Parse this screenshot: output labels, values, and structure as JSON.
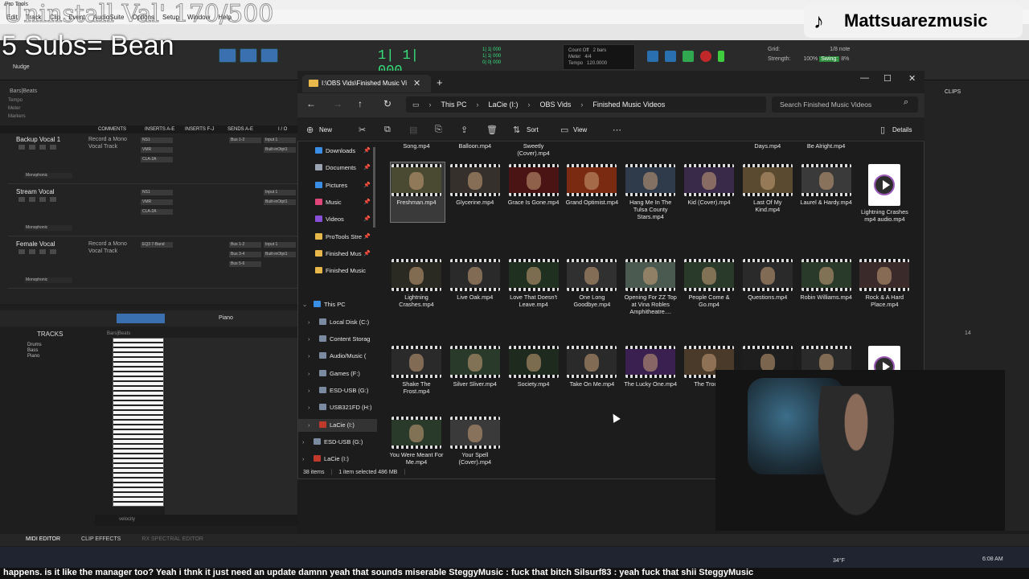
{
  "overlay": {
    "top_text": "Uninstall Val' 170/500",
    "subs_text": "5 Subs= Bean",
    "tiktok_handle": "Mattsuarezmusic"
  },
  "protools": {
    "title": "Pro Tools",
    "menu": [
      "Edit",
      "Track",
      "Clip",
      "Event",
      "AudioSuite",
      "Options",
      "Setup",
      "Window",
      "Help"
    ],
    "nudge": "Nudge",
    "counter": "1| 1| 000",
    "transport_labels": [
      "Count Off",
      "Meter",
      "Tempo"
    ],
    "transport_values": [
      "2 bars",
      "4/4",
      "120.0000"
    ],
    "grid_label": "Grid:",
    "grid_value": "1/8 note",
    "strength_label": "Strength:",
    "strength_value": "100%",
    "swing_label": "Swing:",
    "swing_value": "8%",
    "bars_beats": "Bars|Beats",
    "rulers": [
      "Tempo",
      "Meter",
      "Markers"
    ],
    "columns": [
      "COMMENTS",
      "INSERTS A-E",
      "INSERTS F-J",
      "SENDS A-E",
      "I / O"
    ],
    "tracks": [
      {
        "name": "Backup Vocal 1",
        "comment": "Record a Mono Vocal Track",
        "inserts": [
          "NS1",
          "VMR",
          "CLA-2A"
        ],
        "sends": [
          "Bus 1-2"
        ],
        "io": [
          "Input 1",
          "Built-inOtpt1"
        ],
        "mode": "Monophonic"
      },
      {
        "name": "Stream Vocal",
        "comment": "",
        "inserts": [
          "NS1",
          "VMR",
          "CLA-2A"
        ],
        "sends": [],
        "io": [
          "Input 1",
          "Built-inOtpt1"
        ],
        "mode": "Monophonic"
      },
      {
        "name": "Female Vocal",
        "comment": "Record a Mono Vocal Track",
        "inserts": [
          "EQ3 7-Band"
        ],
        "sends": [
          "Bus 1-2",
          "Bus 3-4",
          "Bus 5-6"
        ],
        "io": [
          "Input 1",
          "Built-inOtpt1"
        ],
        "mode": "Monophonic"
      }
    ],
    "tracks_label": "TRACKS",
    "midi_tracks": [
      "Drums",
      "Bass",
      "Piano"
    ],
    "instrument": "Piano",
    "velocity": "velocity",
    "bottom_tabs": [
      "MIDI EDITOR",
      "CLIP EFFECTS",
      "RX SPECTRAL EDITOR"
    ],
    "clips_label": "CLIPS",
    "ruler_14": "14"
  },
  "explorer": {
    "tab_title": "I:\\OBS Vids\\Finished Music Vi",
    "breadcrumb": [
      "This PC",
      "LaCie (I:)",
      "OBS Vids",
      "Finished Music Videos"
    ],
    "search_placeholder": "Search Finished Music Videos",
    "commands": {
      "new": "New",
      "sort": "Sort",
      "view": "View",
      "details": "Details"
    },
    "nav": [
      {
        "label": "Downloads",
        "color": "#3a8ee6",
        "pinned": true
      },
      {
        "label": "Documents",
        "color": "#9aa4b0",
        "pinned": true
      },
      {
        "label": "Pictures",
        "color": "#3a8ee6",
        "pinned": true
      },
      {
        "label": "Music",
        "color": "#e0467a",
        "pinned": true
      },
      {
        "label": "Videos",
        "color": "#8a4fd8",
        "pinned": true
      },
      {
        "label": "ProTools Stre",
        "color": "#e8b84b",
        "pinned": true
      },
      {
        "label": "Finished Mus",
        "color": "#e8b84b",
        "pinned": true
      },
      {
        "label": "Finished Music",
        "color": "#e8b84b",
        "pinned": false
      }
    ],
    "tree": [
      {
        "label": "This PC",
        "indent": 0
      },
      {
        "label": "Local Disk (C:)",
        "indent": 1
      },
      {
        "label": "Content Storag",
        "indent": 1
      },
      {
        "label": "Audio/Music (",
        "indent": 1
      },
      {
        "label": "Games (F:)",
        "indent": 1
      },
      {
        "label": "ESD-USB (G:)",
        "indent": 1
      },
      {
        "label": "USB321FD (H:)",
        "indent": 1
      },
      {
        "label": "LaCie (I:)",
        "indent": 1
      },
      {
        "label": "ESD-USB (G:)",
        "indent": 0
      },
      {
        "label": "LaCie (I:)",
        "indent": 0
      }
    ],
    "partial_row": [
      "Song.mp4",
      "Balloon.mp4",
      "Sweetly (Cover).mp4",
      "",
      "",
      "",
      "Days.mp4",
      "Be Alright.mp4"
    ],
    "files": [
      {
        "name": "Freshman.mp4",
        "kind": "video",
        "tint": "#4a4a32"
      },
      {
        "name": "Glycerine.mp4",
        "kind": "video",
        "tint": "#35302c"
      },
      {
        "name": "Grace Is Gone.mp4",
        "kind": "video",
        "tint": "#4a1414"
      },
      {
        "name": "Grand Optimist.mp4",
        "kind": "video",
        "tint": "#7a2a10"
      },
      {
        "name": "Hang Me In The Tulsa County Stars.mp4",
        "kind": "video",
        "tint": "#2f3a4a"
      },
      {
        "name": "Kid (Cover).mp4",
        "kind": "video",
        "tint": "#3a2a4a"
      },
      {
        "name": "Last Of My Kind.mp4",
        "kind": "video",
        "tint": "#5a4a30"
      },
      {
        "name": "Laurel & Hardy.mp4",
        "kind": "video",
        "tint": "#3a3a3a"
      },
      {
        "name": "Lightning Crashes mp4 audio.mp4",
        "kind": "audio",
        "tint": "#ffffff"
      },
      {
        "name": "Lightning Crashes.mp4",
        "kind": "video",
        "tint": "#2a2a22"
      },
      {
        "name": "Live Oak.mp4",
        "kind": "video",
        "tint": "#2a2a2a"
      },
      {
        "name": "Love That Doesn't Leave.mp4",
        "kind": "video",
        "tint": "#1f3020"
      },
      {
        "name": "One Long Goodbye.mp4",
        "kind": "video",
        "tint": "#303030"
      },
      {
        "name": "Opening For ZZ Top at Vina Robles Amphitheatre....",
        "kind": "video",
        "tint": "#4a5a50"
      },
      {
        "name": "People Come & Go.mp4",
        "kind": "video",
        "tint": "#2a3a2a"
      },
      {
        "name": "Questions.mp4",
        "kind": "video",
        "tint": "#2a2a2a"
      },
      {
        "name": "Robin Williams.mp4",
        "kind": "video",
        "tint": "#2a3a2a"
      },
      {
        "name": "Rock & A Hard Place.mp4",
        "kind": "video",
        "tint": "#3a2a2a"
      },
      {
        "name": "Shake The Frost.mp4",
        "kind": "video",
        "tint": "#2a2a2a"
      },
      {
        "name": "Silver Sliver.mp4",
        "kind": "video",
        "tint": "#2a3a2a"
      },
      {
        "name": "Society.mp4",
        "kind": "video",
        "tint": "#1e2a1e"
      },
      {
        "name": "Take On Me.mp4",
        "kind": "video",
        "tint": "#2a2a2a"
      },
      {
        "name": "The Lucky One.mp4",
        "kind": "video",
        "tint": "#3a2050"
      },
      {
        "name": "The Troope",
        "kind": "video",
        "tint": "#4a3a2a"
      },
      {
        "name": "",
        "kind": "video",
        "tint": "#1e1e1e"
      },
      {
        "name": "",
        "kind": "video",
        "tint": "#2a2a2a"
      },
      {
        "name": "",
        "kind": "audio",
        "tint": "#ffffff"
      },
      {
        "name": "You Were Meant For Me.mp4",
        "kind": "video",
        "tint": "#2a3a2a"
      },
      {
        "name": "Your Spell (Cover).mp4",
        "kind": "video",
        "tint": "#3a3a3a"
      }
    ],
    "status": {
      "count": "38 items",
      "selection": "1 item selected  486 MB"
    }
  },
  "taskbar": {
    "weather": "34°F",
    "time": "6:08 AM",
    "chat": "happens.  is it like the manager too?  Yeah i thnk it just need an update  damnn  yeah that sounds miserable     SteggyMusic :   fuck that bitch     Silsurf83 :  yeah fuck that shii     SteggyMusic"
  }
}
